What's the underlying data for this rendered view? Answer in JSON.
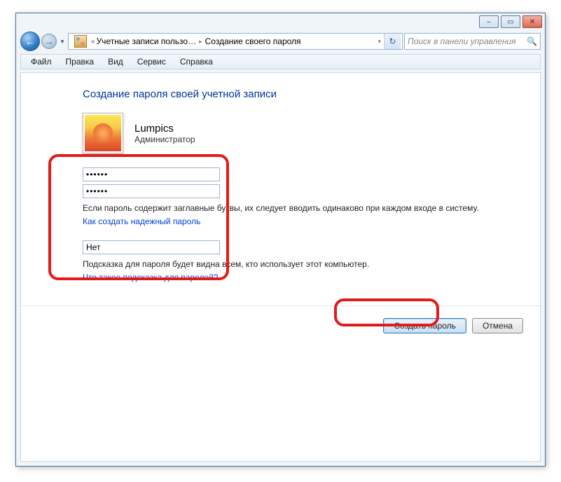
{
  "window": {
    "controls": {
      "min": "–",
      "max": "▭",
      "close": "✕"
    }
  },
  "address": {
    "back_glyph": "←",
    "fwd_glyph": "→",
    "drop_glyph": "▼",
    "chev_left": "«",
    "segment1": "Учетные записи пользо…",
    "segment2": "Создание своего пароля",
    "refresh_glyph": "↻"
  },
  "search": {
    "placeholder": "Поиск в панели управления",
    "mag_glyph": "🔍"
  },
  "menu": {
    "file": "Файл",
    "edit": "Правка",
    "view": "Вид",
    "service": "Сервис",
    "help": "Справка"
  },
  "page": {
    "title": "Создание пароля своей учетной записи"
  },
  "user": {
    "name": "Lumpics",
    "role": "Администратор"
  },
  "form": {
    "password1": "••••••",
    "password2": "••••••",
    "caps_note": "Если пароль содержит заглавные буквы, их следует вводить одинаково при каждом входе в систему.",
    "link_strong": "Как создать надежный пароль",
    "hint_value": "Нет",
    "hint_note": "Подсказка для пароля будет видна всем, кто использует этот компьютер.",
    "link_hint": "Что такое подсказка для паролей?"
  },
  "buttons": {
    "create": "Создать пароль",
    "cancel": "Отмена"
  }
}
